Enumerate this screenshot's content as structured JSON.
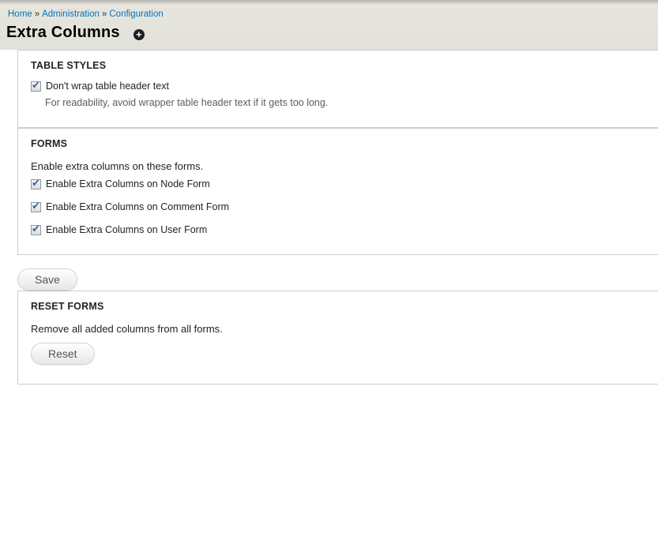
{
  "breadcrumb": {
    "separator": "»",
    "items": [
      {
        "label": "Home"
      },
      {
        "label": "Administration"
      },
      {
        "label": "Configuration"
      }
    ]
  },
  "page": {
    "title": "Extra Columns",
    "title_icon_glyph": "+"
  },
  "icons": {
    "check": "✔"
  },
  "fieldsets": [
    {
      "legend": "TABLE STYLES",
      "checkboxes": [
        {
          "label": "Don't wrap table header text",
          "checked": true,
          "description": "For readability, avoid wrapper table header text if it gets too long."
        }
      ]
    },
    {
      "legend": "FORMS",
      "intro": "Enable extra columns on these forms.",
      "checkboxes": [
        {
          "label": "Enable Extra Columns on Node Form",
          "checked": true
        },
        {
          "label": "Enable Extra Columns on Comment Form",
          "checked": true
        },
        {
          "label": "Enable Extra Columns on User Form",
          "checked": true
        }
      ]
    },
    {
      "legend": "RESET FORMS",
      "intro": "Remove all added columns from all forms.",
      "button_label": "Reset"
    }
  ],
  "actions": {
    "save_label": "Save"
  },
  "colors": {
    "link": "#0074bd",
    "header_band": "#e2e1d9",
    "panel_border": "#cccccc",
    "text": "#232323",
    "description": "#5c5c5c",
    "check": "#3f66a0"
  }
}
